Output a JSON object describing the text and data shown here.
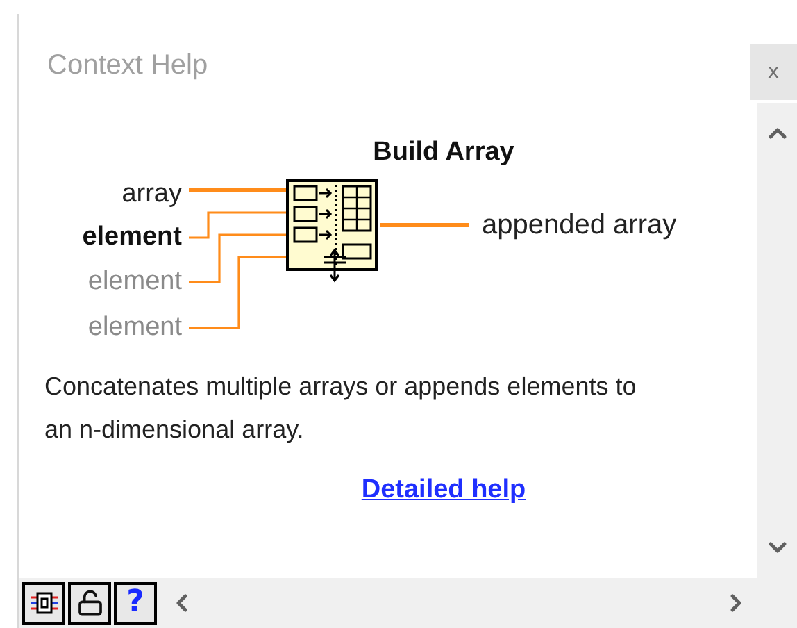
{
  "window": {
    "title": "Context Help",
    "close": "x"
  },
  "function": {
    "title": "Build Array",
    "inputs": [
      {
        "label": "array",
        "kind": "recommended"
      },
      {
        "label": "element",
        "kind": "required"
      },
      {
        "label": "element",
        "kind": "optional"
      },
      {
        "label": "element",
        "kind": "optional"
      }
    ],
    "output": {
      "label": "appended array"
    },
    "description": "Concatenates multiple arrays or appends elements to an n-dimensional array.",
    "link": "Detailed help"
  },
  "toolbar": {
    "help_button": "?"
  }
}
